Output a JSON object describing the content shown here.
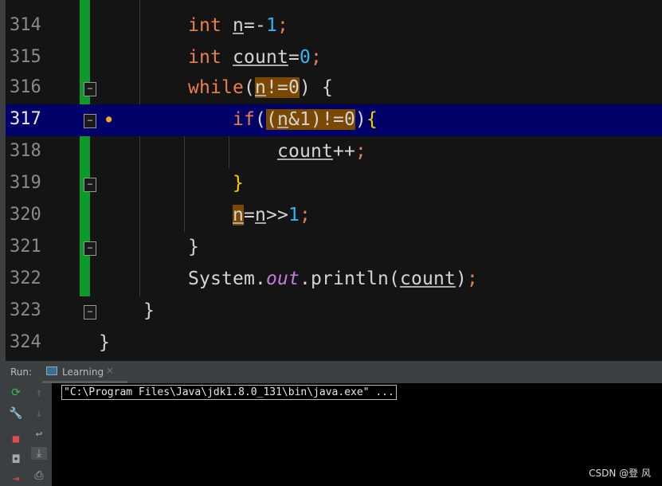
{
  "editor": {
    "lines": [
      {
        "n": "314"
      },
      {
        "n": "315"
      },
      {
        "n": "316"
      },
      {
        "n": "317"
      },
      {
        "n": "318"
      },
      {
        "n": "319"
      },
      {
        "n": "320"
      },
      {
        "n": "321"
      },
      {
        "n": "322"
      },
      {
        "n": "323"
      },
      {
        "n": "324"
      }
    ],
    "colors": {
      "keyword": "#e8804e",
      "number": "#33b5ee",
      "current_line": "#000068",
      "match_highlight": "#7a4800",
      "changed_gutter": "#0d9a2a"
    }
  },
  "run_panel": {
    "label": "Run:",
    "tab": "Learning",
    "console_text": "\"C:\\Program Files\\Java\\jdk1.8.0_131\\bin\\java.exe\" ..."
  },
  "watermark": "CSDN @登 风"
}
